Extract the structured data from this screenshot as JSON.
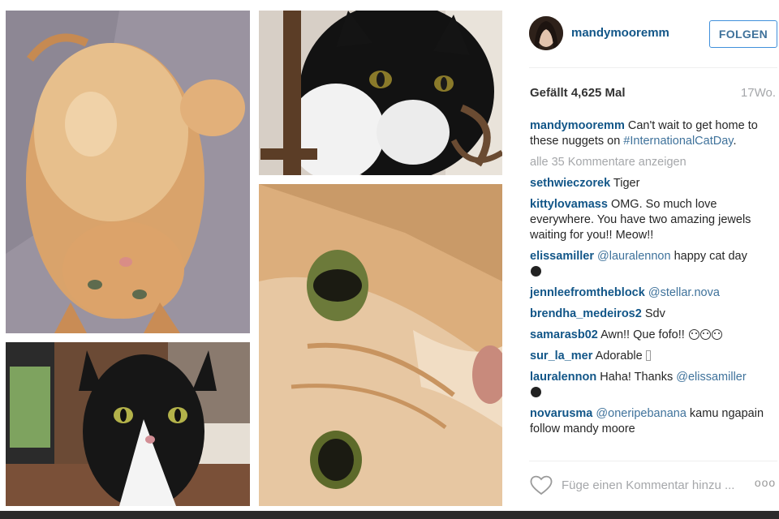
{
  "post": {
    "username": "mandymooremm",
    "follow_label": "FOLGEN",
    "likes": "Gefällt 4,625 Mal",
    "time_ago": "17Wo."
  },
  "caption": {
    "user": "mandymooremm",
    "text": "Can't wait to get home to these nuggets on ",
    "hashtag": "#InternationalCatDay",
    "end": "."
  },
  "show_all": "alle 35 Kommentare anzeigen",
  "comments": [
    {
      "user": "sethwieczorek",
      "text": "Tiger"
    },
    {
      "user": "kittylovamass",
      "text": "OMG. So much love everywhere. You have two amazing jewels waiting for you!! Meow!!"
    },
    {
      "user": "elissamiller",
      "mention": "@lauralennon",
      "text": "happy cat day"
    },
    {
      "user": "jennleefromtheblock",
      "mention": "@stellar.nova",
      "text": ""
    },
    {
      "user": "brendha_medeiros2",
      "text": "Sdv"
    },
    {
      "user": "samarasb02",
      "text": "Awn!! Que fofo!!"
    },
    {
      "user": "sur_la_mer",
      "text": "Adorable"
    },
    {
      "user": "lauralennon",
      "text": "Haha! Thanks",
      "mention": "@elissamiller"
    },
    {
      "user": "novarusma",
      "mention": "@oneripebanana",
      "text": "kamu ngapain follow mandy moore"
    }
  ],
  "compose": {
    "placeholder": "Füge einen Kommentar hinzu ...",
    "more_label": "ooo"
  },
  "icons": {
    "heart": "heart-icon",
    "more": "more-options-icon"
  },
  "colors": {
    "username_blue": "#125688",
    "link_blue": "#3f729b",
    "muted": "#a5a7aa"
  }
}
